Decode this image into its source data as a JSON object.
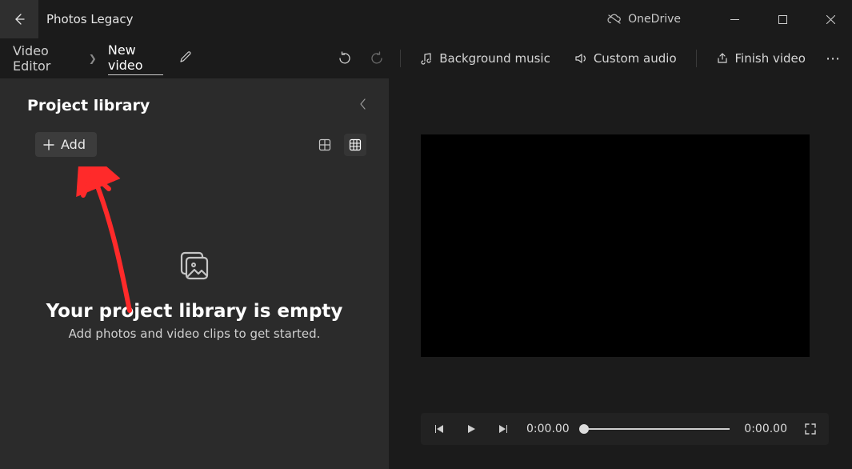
{
  "titlebar": {
    "app_title": "Photos Legacy",
    "onedrive_label": "OneDrive"
  },
  "toolbar": {
    "breadcrumb_page": "Video Editor",
    "project_name": "New video",
    "bg_music_label": "Background music",
    "custom_audio_label": "Custom audio",
    "finish_label": "Finish video"
  },
  "library": {
    "title": "Project library",
    "add_label": "Add",
    "empty_title": "Your project library is empty",
    "empty_sub": "Add photos and video clips to get started."
  },
  "player": {
    "current_time": "0:00.00",
    "total_time": "0:00.00"
  }
}
